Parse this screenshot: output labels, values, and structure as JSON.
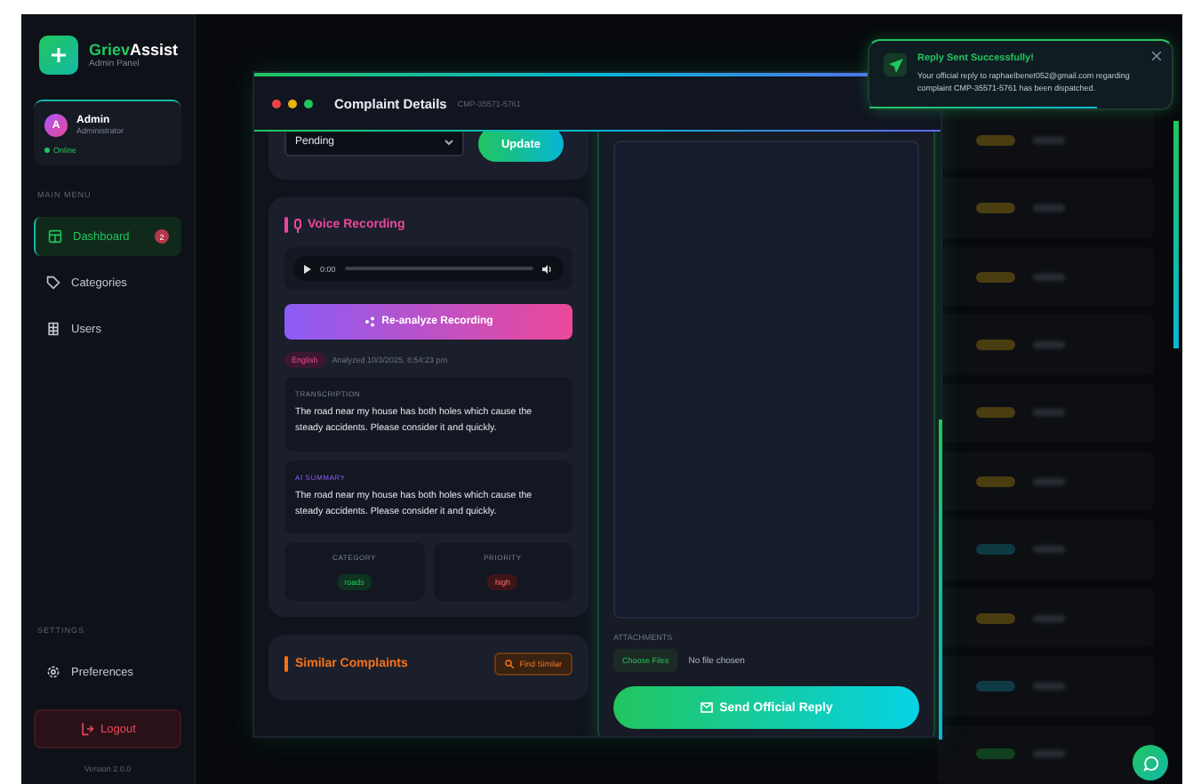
{
  "sidebar": {
    "logo_text": {
      "accent": "Griev",
      "rest": "Assist"
    },
    "logo_subtitle": "Admin Panel",
    "profile": {
      "avatar": "A",
      "name": "Admin",
      "role": "Administrator",
      "status": "Online"
    },
    "main_menu_label": "MAIN MENU",
    "items": [
      {
        "label": "Dashboard",
        "selected": true,
        "badge": "2"
      },
      {
        "label": "Categories",
        "selected": false
      },
      {
        "label": "Users",
        "selected": false
      }
    ],
    "settings_label": "SETTINGS",
    "settings_items": [
      {
        "label": "Preferences"
      }
    ],
    "logout": "Logout",
    "version": "Version 2.0.0"
  },
  "background_rows": [
    {
      "color": "#4a3d10"
    },
    {
      "color": "#4a3d10"
    },
    {
      "color": "#4a3d10"
    },
    {
      "color": "#4a3d10"
    },
    {
      "color": "#4a3d10"
    },
    {
      "color": "#4a3d10"
    },
    {
      "color": "#0e3a44"
    },
    {
      "color": "#4a3d10"
    },
    {
      "color": "#0e3a44"
    },
    {
      "color": "#10401f"
    }
  ],
  "modal": {
    "title": "Complaint Details",
    "subtitle": "CMP-35571-5761",
    "status": {
      "value": "Pending",
      "button": "Update"
    },
    "voice": {
      "title": "Voice Recording",
      "time": "0:00",
      "reanalyze": "Re-analyze Recording",
      "language": "English",
      "analyzed": "Analyzed 10/3/2025, 8:54:23 pm",
      "transcription": {
        "label": "TRANSCRIPTION",
        "text": "The road near my house has both holes which cause the steady accidents. Please consider it and quickly."
      },
      "summary": {
        "label": "AI SUMMARY",
        "text": "The road near my house has both holes which cause the steady accidents. Please consider it and quickly."
      },
      "category": {
        "label": "CATEGORY",
        "value": "roads"
      },
      "priority": {
        "label": "PRIORITY",
        "value": "high"
      }
    },
    "similar": {
      "title": "Similar Complaints",
      "button": "Find Similar"
    },
    "reply": {
      "attachments_label": "ATTACHMENTS",
      "choose": "Choose Files",
      "no_file": "No file chosen",
      "send": "Send Official Reply"
    }
  },
  "toast": {
    "title": "Reply Sent Successfully!",
    "message": "Your official reply to raphaelbenet052@gmail.com regarding complaint CMP-35571-5761 has been dispatched.",
    "level": 0.75
  }
}
